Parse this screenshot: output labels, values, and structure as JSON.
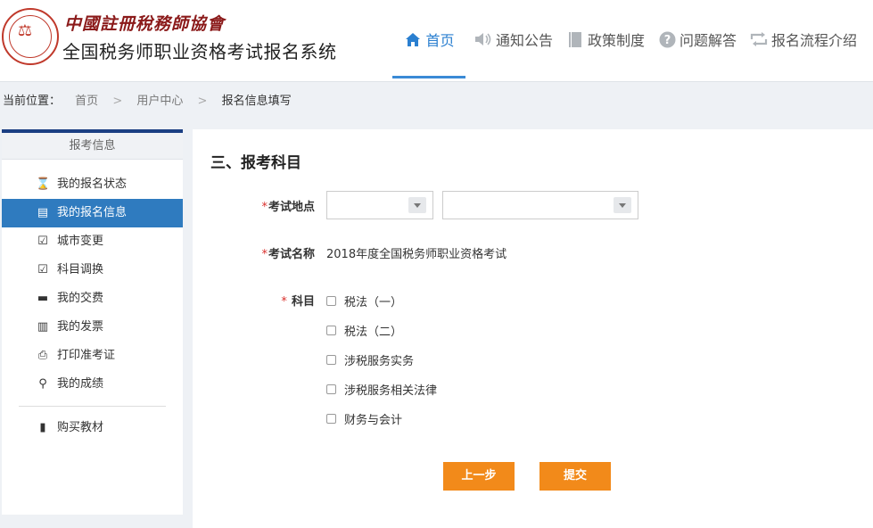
{
  "header": {
    "association_name": "中國註冊稅務師協會",
    "system_title": "全国税务师职业资格考试报名系统",
    "nav": [
      {
        "label": "首页",
        "icon": "home-icon"
      },
      {
        "label": "通知公告",
        "icon": "speaker-icon"
      },
      {
        "label": "政策制度",
        "icon": "book-icon"
      },
      {
        "label": "问题解答",
        "icon": "question-icon"
      },
      {
        "label": "报名流程介绍",
        "icon": "refresh-icon"
      }
    ],
    "accent_color": "#2a7fd0"
  },
  "breadcrumb": {
    "prefix": "当前位置：",
    "items": [
      "首页",
      "用户中心",
      "报名信息填写"
    ],
    "separator": ">"
  },
  "sidebar": {
    "header": "报考信息",
    "items": [
      {
        "label": "我的报名状态",
        "icon": "hourglass-icon"
      },
      {
        "label": "我的报名信息",
        "icon": "list-icon"
      },
      {
        "label": "城市变更",
        "icon": "edit-icon"
      },
      {
        "label": "科目调换",
        "icon": "edit-icon"
      },
      {
        "label": "我的交费",
        "icon": "card-icon"
      },
      {
        "label": "我的发票",
        "icon": "barcode-icon"
      },
      {
        "label": "打印准考证",
        "icon": "print-icon"
      },
      {
        "label": "我的成绩",
        "icon": "search-icon"
      }
    ],
    "extra": {
      "label": "购买教材",
      "icon": "book-icon"
    },
    "active_color": "#2f7bbf"
  },
  "form": {
    "section_title": "三、报考科目",
    "location_label": "考试地点",
    "exam_name_label": "考试名称",
    "exam_name_value": "2018年度全国税务师职业资格考试",
    "subject_label": "科目",
    "subjects": [
      "税法（一）",
      "税法（二）",
      "涉税服务实务",
      "涉税服务相关法律",
      "财务与会计"
    ],
    "prev_button": "上一步",
    "submit_button": "提交",
    "button_color": "#f28a1a"
  }
}
